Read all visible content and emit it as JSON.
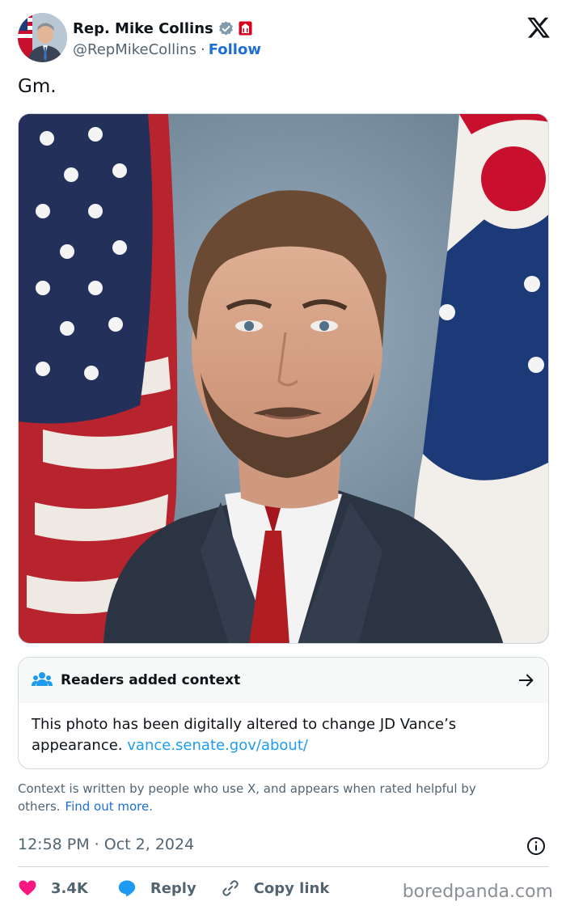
{
  "author": {
    "name": "Rep. Mike Collins",
    "handle": "@RepMikeCollins",
    "separator": "·",
    "follow_label": "Follow",
    "verified_icon": "verified-badge-icon",
    "affiliation_icon": "us-house-badge-icon"
  },
  "platform_logo": "x-logo-icon",
  "tweet": {
    "text": "Gm."
  },
  "media": {
    "icon": "portrait-photo"
  },
  "community_note": {
    "title": "Readers added context",
    "body": "This photo has been digitally altered to change JD Vance’s appearance.",
    "link": "vance.senate.gov/about/",
    "icon": "people-icon",
    "arrow_icon": "arrow-right-icon"
  },
  "disclaimer": {
    "text": "Context is written by people who use X, and appears when rated helpful by others.",
    "link": "Find out more."
  },
  "meta": {
    "timestamp": "12:58 PM · Oct 2, 2024",
    "info_icon": "info-icon"
  },
  "actions": {
    "likes": "3.4K",
    "reply": "Reply",
    "copy_link": "Copy link"
  },
  "watermark": "boredpanda.com",
  "colors": {
    "link_blue": "#1d9bf0",
    "follow_blue": "#1d6fd6",
    "like_red": "#f91880",
    "muted_gray": "#536471"
  }
}
